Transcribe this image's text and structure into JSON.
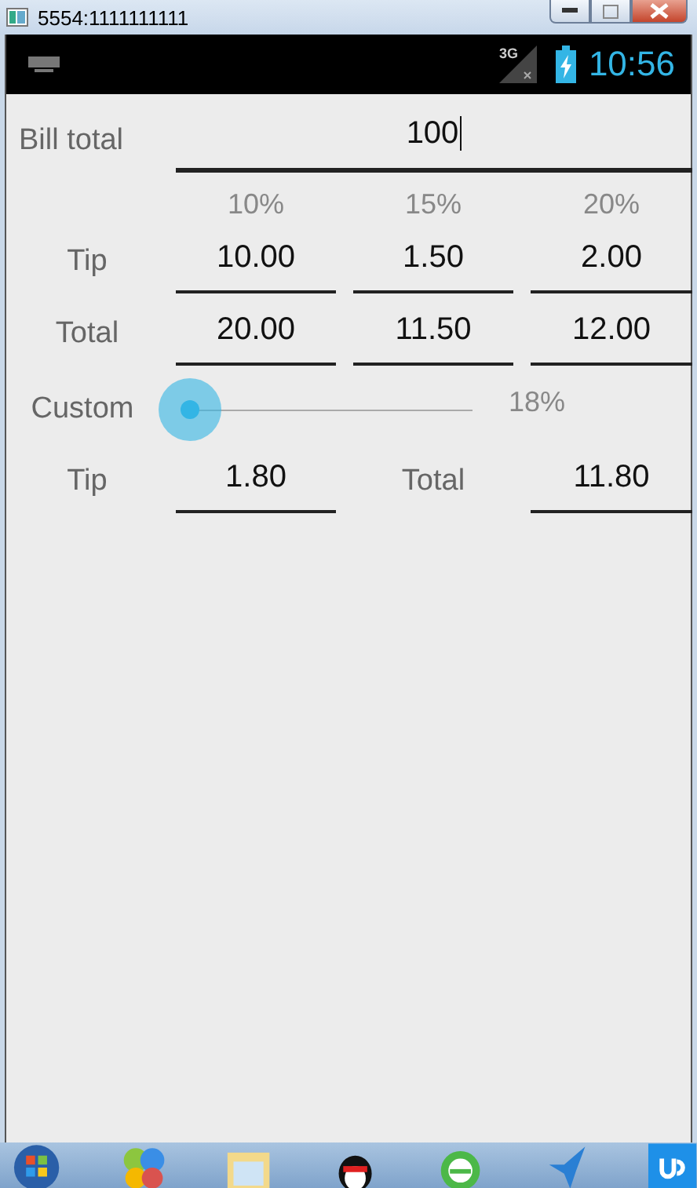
{
  "window": {
    "title": "5554:1111111111"
  },
  "status_bar": {
    "network": "3G",
    "time": "10:56"
  },
  "bill": {
    "label": "Bill total",
    "value": "100"
  },
  "percent_columns": [
    "10%",
    "15%",
    "20%"
  ],
  "rows": [
    {
      "label": "Tip",
      "values": [
        "10.00",
        "1.50",
        "2.00"
      ]
    },
    {
      "label": "Total",
      "values": [
        "20.00",
        "11.50",
        "12.00"
      ]
    }
  ],
  "custom": {
    "label": "Custom",
    "level": 0,
    "reading": "18%"
  },
  "custom_results": [
    {
      "label": "Tip",
      "value": "1.80"
    },
    {
      "label": "Total",
      "value": "11.80"
    }
  ]
}
